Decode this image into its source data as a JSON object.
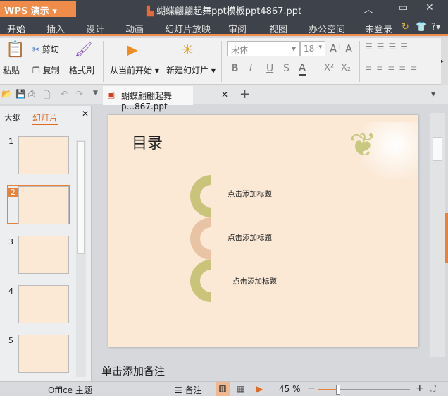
{
  "app": {
    "name": "WPS 演示",
    "title": "蝴蝶翩翩起舞ppt模板ppt4867.ppt"
  },
  "menu": [
    "开始",
    "插入",
    "设计",
    "动画",
    "幻灯片放映",
    "审阅",
    "视图",
    "办公空间"
  ],
  "account": "未登录",
  "ribbon": {
    "paste": "粘贴",
    "cut": "剪切",
    "copy": "复制",
    "format_painter": "格式刷",
    "from_current": "从当前开始",
    "new_slide": "新建幻灯片",
    "font": "宋体",
    "size": "18",
    "bold": "B",
    "italic": "I",
    "underline": "U",
    "strike": "S",
    "fontcolor": "A",
    "sup": "X²",
    "sub": "X₂"
  },
  "doc_tab": "蝴蝶翩翩起舞p...867.ppt",
  "left_tabs": [
    "大纲",
    "幻灯片"
  ],
  "thumbnails": [
    "1",
    "2",
    "3",
    "4",
    "5"
  ],
  "slide": {
    "title": "目录",
    "items": [
      "点击添加标题",
      "点击添加标题",
      "点击添加标题"
    ],
    "colors": [
      "#c9c47a",
      "#e8c4a4",
      "#c9c47a"
    ]
  },
  "notes": "单击添加备注",
  "status": {
    "theme": "Office 主题",
    "notes": "备注",
    "zoom": "45 %",
    "zoom_value": 45
  }
}
